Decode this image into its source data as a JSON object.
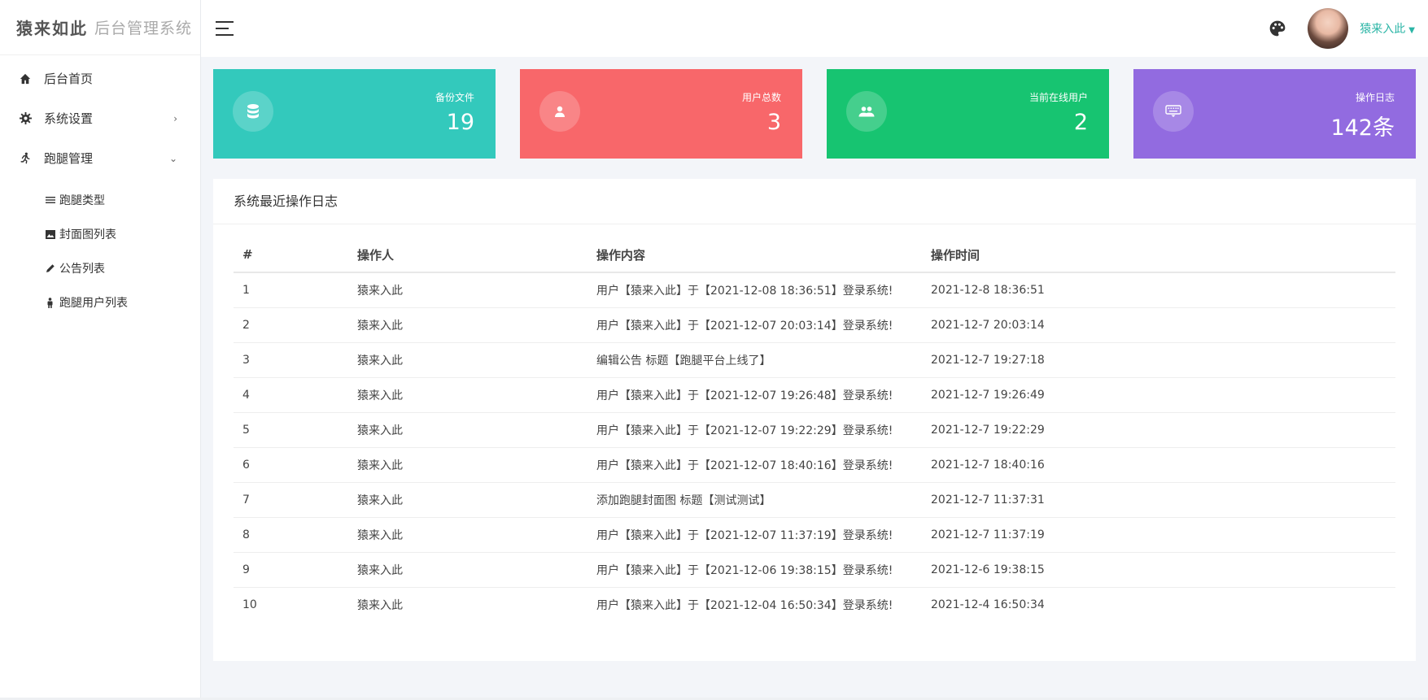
{
  "brand": {
    "name": "猿来如此",
    "subtitle": "后台管理系统"
  },
  "sidebar": {
    "items": [
      {
        "label": "后台首页",
        "icon": "home-icon"
      },
      {
        "label": "系统设置",
        "icon": "gear-icon",
        "arrow": "›"
      },
      {
        "label": "跑腿管理",
        "icon": "runner-icon",
        "arrow": "⌄"
      }
    ],
    "subitems": [
      {
        "label": "跑腿类型",
        "icon": "list-icon"
      },
      {
        "label": "封面图列表",
        "icon": "image-icon"
      },
      {
        "label": "公告列表",
        "icon": "pencil-icon"
      },
      {
        "label": "跑腿用户列表",
        "icon": "person-icon"
      }
    ]
  },
  "header": {
    "user_name": "猿来入此"
  },
  "stats": [
    {
      "title": "备份文件",
      "value": "19",
      "color": "#33c9bc",
      "icon": "database-icon"
    },
    {
      "title": "用户总数",
      "value": "3",
      "color": "#f8676a",
      "icon": "user-icon"
    },
    {
      "title": "当前在线用户",
      "value": "2",
      "color": "#17c471",
      "icon": "users-icon"
    },
    {
      "title": "操作日志",
      "value": "142条",
      "color": "#926be0",
      "icon": "keyboard-icon"
    }
  ],
  "log_panel": {
    "title": "系统最近操作日志",
    "columns": [
      "#",
      "操作人",
      "操作内容",
      "操作时间"
    ],
    "rows": [
      [
        "1",
        "猿来入此",
        "用户【猿来入此】于【2021-12-08 18:36:51】登录系统!",
        "2021-12-8 18:36:51"
      ],
      [
        "2",
        "猿来入此",
        "用户【猿来入此】于【2021-12-07 20:03:14】登录系统!",
        "2021-12-7 20:03:14"
      ],
      [
        "3",
        "猿来入此",
        "编辑公告 标题【跑腿平台上线了】",
        "2021-12-7 19:27:18"
      ],
      [
        "4",
        "猿来入此",
        "用户【猿来入此】于【2021-12-07 19:26:48】登录系统!",
        "2021-12-7 19:26:49"
      ],
      [
        "5",
        "猿来入此",
        "用户【猿来入此】于【2021-12-07 19:22:29】登录系统!",
        "2021-12-7 19:22:29"
      ],
      [
        "6",
        "猿来入此",
        "用户【猿来入此】于【2021-12-07 18:40:16】登录系统!",
        "2021-12-7 18:40:16"
      ],
      [
        "7",
        "猿来入此",
        "添加跑腿封面图 标题【测试测试】",
        "2021-12-7 11:37:31"
      ],
      [
        "8",
        "猿来入此",
        "用户【猿来入此】于【2021-12-07 11:37:19】登录系统!",
        "2021-12-7 11:37:19"
      ],
      [
        "9",
        "猿来入此",
        "用户【猿来入此】于【2021-12-06 19:38:15】登录系统!",
        "2021-12-6 19:38:15"
      ],
      [
        "10",
        "猿来入此",
        "用户【猿来入此】于【2021-12-04 16:50:34】登录系统!",
        "2021-12-4 16:50:34"
      ]
    ]
  }
}
